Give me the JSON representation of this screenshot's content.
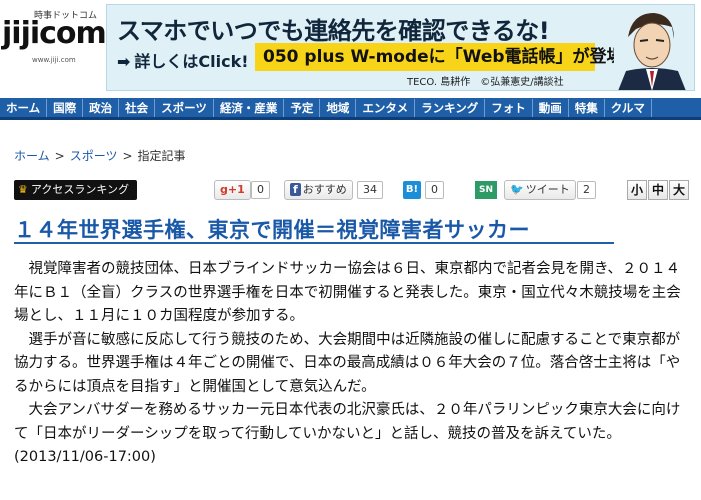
{
  "logo": {
    "top_text": "時事ドットコム",
    "mark": "jijicom",
    "url": "www.jiji.com"
  },
  "banner": {
    "headline": "スマホでいつでも連絡先を確認できるな!",
    "click_text": "詳しくはClick!",
    "yellow_text": "050 plus W-modeに「Web電話帳」が登場!",
    "credit": "TECO. 島耕作　©弘兼憲史/講談社"
  },
  "nav": {
    "items": [
      "ホーム",
      "国際",
      "政治",
      "社会",
      "スポーツ",
      "経済・産業",
      "予定",
      "地域",
      "エンタメ",
      "ランキング",
      "フォト",
      "動画",
      "特集",
      "クルマ"
    ]
  },
  "breadcrumb": {
    "home": "ホーム",
    "sports": "スポーツ",
    "current": "指定記事",
    "sep": ">"
  },
  "toolbar": {
    "ranking": "アクセスランキング",
    "gplus_label": "g+1",
    "gplus_count": "0",
    "fb_label": "おすすめ",
    "fb_count": "34",
    "hatena_label": "B!",
    "hatena_count": "0",
    "sn_label": "SN",
    "tweet_label": "ツイート",
    "tweet_count": "2",
    "size_small": "小",
    "size_medium": "中",
    "size_large": "大"
  },
  "article": {
    "headline": "１４年世界選手権、東京で開催＝視覚障害者サッカー",
    "paragraphs": [
      "視覚障害者の競技団体、日本ブラインドサッカー協会は６日、東京都内で記者会見を開き、２０１４年にＢ１（全盲）クラスの世界選手権を日本で初開催すると発表した。東京・国立代々木競技場を主会場とし、１１月に１０カ国程度が参加する。",
      "選手が音に敏感に反応して行う競技のため、大会期間中は近隣施設の催しに配慮することで東京都が協力する。世界選手権は４年ごとの開催で、日本の最高成績は０６年大会の７位。落合啓士主将は「やるからには頂点を目指す」と開催国として意気込んだ。",
      "大会アンバサダーを務めるサッカー元日本代表の北沢豪氏は、２０年パラリンピック東京大会に向けて「日本がリーダーシップを取って行動していかないと」と話し、競技の普及を訴えていた。　(2013/11/06-17:00)"
    ]
  }
}
